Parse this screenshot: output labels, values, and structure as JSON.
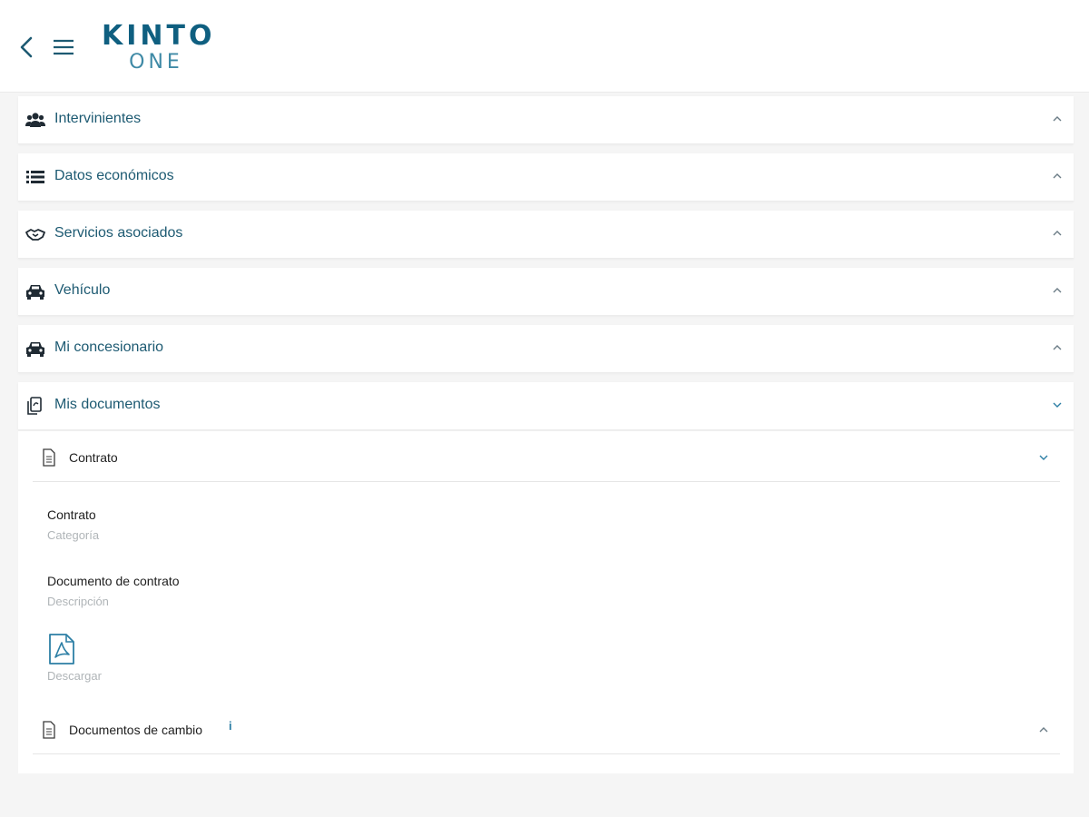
{
  "app": {
    "logo_text": "KINTO",
    "logo_subtext": "ONE"
  },
  "sections": [
    {
      "label": "Intervinientes",
      "icon": "users-icon",
      "state": "collapsed"
    },
    {
      "label": "Datos económicos",
      "icon": "list-icon",
      "state": "collapsed"
    },
    {
      "label": "Servicios asociados",
      "icon": "handshake-icon",
      "state": "collapsed"
    },
    {
      "label": "Vehículo",
      "icon": "car-icon",
      "state": "collapsed"
    },
    {
      "label": "Mi concesionario",
      "icon": "car-icon",
      "state": "collapsed"
    },
    {
      "label": "Mis documentos",
      "icon": "documents-icon",
      "state": "expanded"
    }
  ],
  "documents": {
    "contract": {
      "title": "Contrato",
      "category_value": "Contrato",
      "category_label": "Categoría",
      "description_value": "Documento de contrato",
      "description_label": "Descripción",
      "download_label": "Descargar"
    },
    "change_docs": {
      "title": "Documentos de cambio",
      "info": "i"
    }
  },
  "colors": {
    "primary": "#1d5a72",
    "logo": "#0f5f80",
    "muted": "#b0b5b8",
    "background": "#f5f5f5"
  }
}
